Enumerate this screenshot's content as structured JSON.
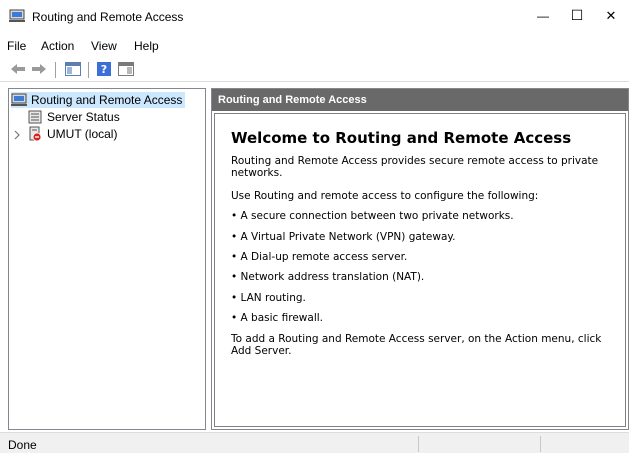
{
  "window": {
    "title": "Routing and Remote Access",
    "minimize_glyph": "—",
    "maximize_glyph": "☐",
    "close_glyph": "✕"
  },
  "menubar": {
    "items": [
      "File",
      "Action",
      "View",
      "Help"
    ]
  },
  "toolbar": {
    "buttons": [
      "back-arrow-icon",
      "forward-arrow-icon",
      "show-hide-console-tree-icon",
      "help-icon",
      "action-pane-icon"
    ]
  },
  "tree": {
    "root_label": "Routing and Remote Access",
    "items": [
      {
        "label": "Server Status",
        "icon": "server-status-icon"
      },
      {
        "label": "UMUT (local)",
        "icon": "server-stopped-icon"
      }
    ]
  },
  "content": {
    "header": "Routing and Remote Access",
    "heading": "Welcome to Routing and Remote Access",
    "intro": "Routing and Remote Access provides secure remote access to private networks.",
    "configure_intro": "Use Routing and remote access to configure the following:",
    "bullets": [
      "• A secure connection between two private networks.",
      "• A Virtual Private Network (VPN) gateway.",
      "• A Dial-up remote access server.",
      "• Network address translation (NAT).",
      "• LAN routing.",
      "• A basic firewall."
    ],
    "add_server": "To add a Routing and Remote Access server, on the Action menu, click Add Server."
  },
  "status": {
    "text": "Done"
  },
  "colors": {
    "selection": "#cce8ff",
    "header_bg": "#696969",
    "status_bg": "#f0f0f0"
  }
}
